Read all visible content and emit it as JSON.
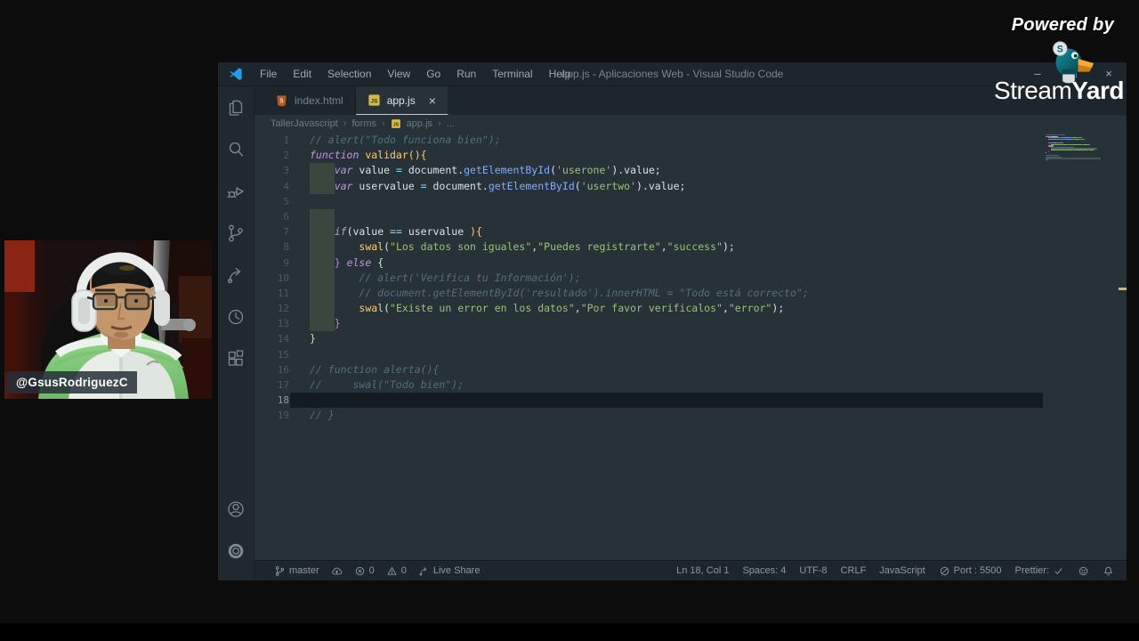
{
  "overlay": {
    "powered_by": "Powered by",
    "brand_stream": "Stream",
    "brand_yard": "Yard",
    "coin_letter": "S",
    "webcam_handle": "@GsusRodriguezC"
  },
  "window": {
    "title": "app.js - Aplicaciones Web - Visual Studio Code",
    "menu": [
      "File",
      "Edit",
      "Selection",
      "View",
      "Go",
      "Run",
      "Terminal",
      "Help"
    ],
    "controls": [
      {
        "name": "minimize",
        "glyph": "–"
      },
      {
        "name": "maximize",
        "glyph": "□"
      },
      {
        "name": "close",
        "glyph": "×"
      }
    ],
    "tabs": [
      {
        "label": "index.html",
        "icon": "html",
        "active": false,
        "close": ""
      },
      {
        "label": "app.js",
        "icon": "js",
        "active": true,
        "close": "×"
      }
    ],
    "breadcrumb_sep": "›",
    "breadcrumb": [
      {
        "label": "TallerJavascript"
      },
      {
        "label": "forms"
      },
      {
        "label": "app.js",
        "icon": "js"
      },
      {
        "label": "..."
      }
    ]
  },
  "activity_bar": [
    "explorer",
    "search",
    "run-debug",
    "source-control",
    "live-share",
    "history",
    "extensions"
  ],
  "activity_bottom": [
    "account",
    "settings"
  ],
  "editor": {
    "current_line": 18,
    "lines": [
      {
        "n": 1,
        "t": [
          [
            "cm",
            "// alert(\"Todo funciona bien\");"
          ]
        ]
      },
      {
        "n": 2,
        "t": [
          [
            "kw",
            "function "
          ],
          [
            "fn",
            "validar"
          ],
          [
            "br",
            "(){"
          ]
        ]
      },
      {
        "n": 3,
        "tint": 1,
        "t": [
          [
            "tx",
            "    "
          ],
          [
            "kw",
            "var "
          ],
          [
            "tx",
            "value "
          ],
          [
            "op",
            "= "
          ],
          [
            "tx",
            "document."
          ],
          [
            "mf",
            "getElementById"
          ],
          [
            "tx",
            "("
          ],
          [
            "st",
            "'userone'"
          ],
          [
            "tx",
            ")."
          ],
          [
            "tx",
            "value;"
          ]
        ]
      },
      {
        "n": 4,
        "tint": 1,
        "t": [
          [
            "tx",
            "    "
          ],
          [
            "kw",
            "var "
          ],
          [
            "tx",
            "uservalue "
          ],
          [
            "op",
            "= "
          ],
          [
            "tx",
            "document."
          ],
          [
            "mf",
            "getElementById"
          ],
          [
            "tx",
            "("
          ],
          [
            "st",
            "'usertwo'"
          ],
          [
            "tx",
            ")."
          ],
          [
            "tx",
            "value;"
          ]
        ]
      },
      {
        "n": 5,
        "t": []
      },
      {
        "n": 6,
        "tint": 1,
        "t": []
      },
      {
        "n": 7,
        "tint": 1,
        "t": [
          [
            "tx",
            "    "
          ],
          [
            "kw",
            "if"
          ],
          [
            "tx",
            "("
          ],
          [
            "tx",
            "value "
          ],
          [
            "op",
            "== "
          ],
          [
            "tx",
            "uservalue "
          ],
          [
            "br",
            "){"
          ]
        ]
      },
      {
        "n": 8,
        "tint": 1,
        "t": [
          [
            "tx",
            "        "
          ],
          [
            "fn",
            "swal"
          ],
          [
            "tx",
            "("
          ],
          [
            "st",
            "\"Los datos son iguales\""
          ],
          [
            "tx",
            ","
          ],
          [
            "st",
            "\"Puedes registrarte\""
          ],
          [
            "tx",
            ","
          ],
          [
            "st",
            "\"success\""
          ],
          [
            "tx",
            ");"
          ]
        ]
      },
      {
        "n": 9,
        "tint": 1,
        "t": [
          [
            "tx",
            "    "
          ],
          [
            "br2",
            "} "
          ],
          [
            "kw",
            "else"
          ],
          [
            "tx",
            " {"
          ]
        ]
      },
      {
        "n": 10,
        "tint": 1,
        "t": [
          [
            "tx",
            "        "
          ],
          [
            "cm",
            "// alert('Verifica tu Información');"
          ]
        ]
      },
      {
        "n": 11,
        "tint": 1,
        "t": [
          [
            "tx",
            "        "
          ],
          [
            "cm",
            "// document.getElementById('resultado').innerHTML = \"Todo está correcto\";"
          ]
        ]
      },
      {
        "n": 12,
        "tint": 1,
        "t": [
          [
            "tx",
            "        "
          ],
          [
            "fn",
            "swal"
          ],
          [
            "tx",
            "("
          ],
          [
            "st",
            "\"Existe un error en los datos\""
          ],
          [
            "tx",
            ","
          ],
          [
            "st",
            "\"Por favor verificalos\""
          ],
          [
            "tx",
            ","
          ],
          [
            "st",
            "\"error\""
          ],
          [
            "tx",
            ");"
          ]
        ]
      },
      {
        "n": 13,
        "tint": 1,
        "t": [
          [
            "tx",
            "    "
          ],
          [
            "br2",
            "}"
          ]
        ]
      },
      {
        "n": 14,
        "t": [
          [
            "br",
            "}"
          ]
        ]
      },
      {
        "n": 15,
        "t": []
      },
      {
        "n": 16,
        "t": [
          [
            "cm",
            "// function alerta(){"
          ]
        ]
      },
      {
        "n": 17,
        "t": [
          [
            "cm",
            "//     swal(\"Todo bien\");"
          ]
        ]
      },
      {
        "n": 18,
        "current": true,
        "t": []
      },
      {
        "n": 19,
        "t": [
          [
            "cm",
            "// }"
          ]
        ]
      }
    ]
  },
  "status": {
    "left": [
      {
        "name": "branch",
        "icon": "git-branch",
        "label": "master"
      },
      {
        "name": "publish",
        "icon": "cloud-upload",
        "label": ""
      },
      {
        "name": "errors",
        "icon": "error",
        "label": "0"
      },
      {
        "name": "warnings",
        "icon": "warning",
        "label": "0"
      },
      {
        "name": "live-share",
        "icon": "live-share",
        "label": "Live Share"
      }
    ],
    "right": [
      {
        "name": "cursor-position",
        "label": "Ln 18, Col 1"
      },
      {
        "name": "indentation",
        "label": "Spaces: 4"
      },
      {
        "name": "encoding",
        "label": "UTF-8"
      },
      {
        "name": "eol",
        "label": "CRLF"
      },
      {
        "name": "language",
        "label": "JavaScript"
      },
      {
        "name": "port",
        "icon": "circle-slash",
        "label": "Port : 5500"
      },
      {
        "name": "prettier",
        "label": "Prettier:",
        "icon_after": "check"
      },
      {
        "name": "feedback",
        "icon": "feedback",
        "label": ""
      },
      {
        "name": "notifications",
        "icon": "bell",
        "label": ""
      }
    ]
  },
  "colors": {
    "accent_blue": "#1f9cf0",
    "editor_bg": "#263238",
    "chrome_bg": "#1d262c",
    "keyword": "#c792ea",
    "string": "#98c379",
    "function": "#ffcb6b",
    "method": "#82aaff",
    "comment": "#546e7a",
    "operator": "#89ddff",
    "brace_alt": "#cc7ad6",
    "indent_tint": "#bad66a",
    "overview_marker": "#d8b94d",
    "html_icon": "#e0772e",
    "js_icon": "#d6b94c",
    "streamyard_teal": "#0b6775",
    "beak_orange": "#f4a93a",
    "jacket_green": "#8fd283"
  }
}
